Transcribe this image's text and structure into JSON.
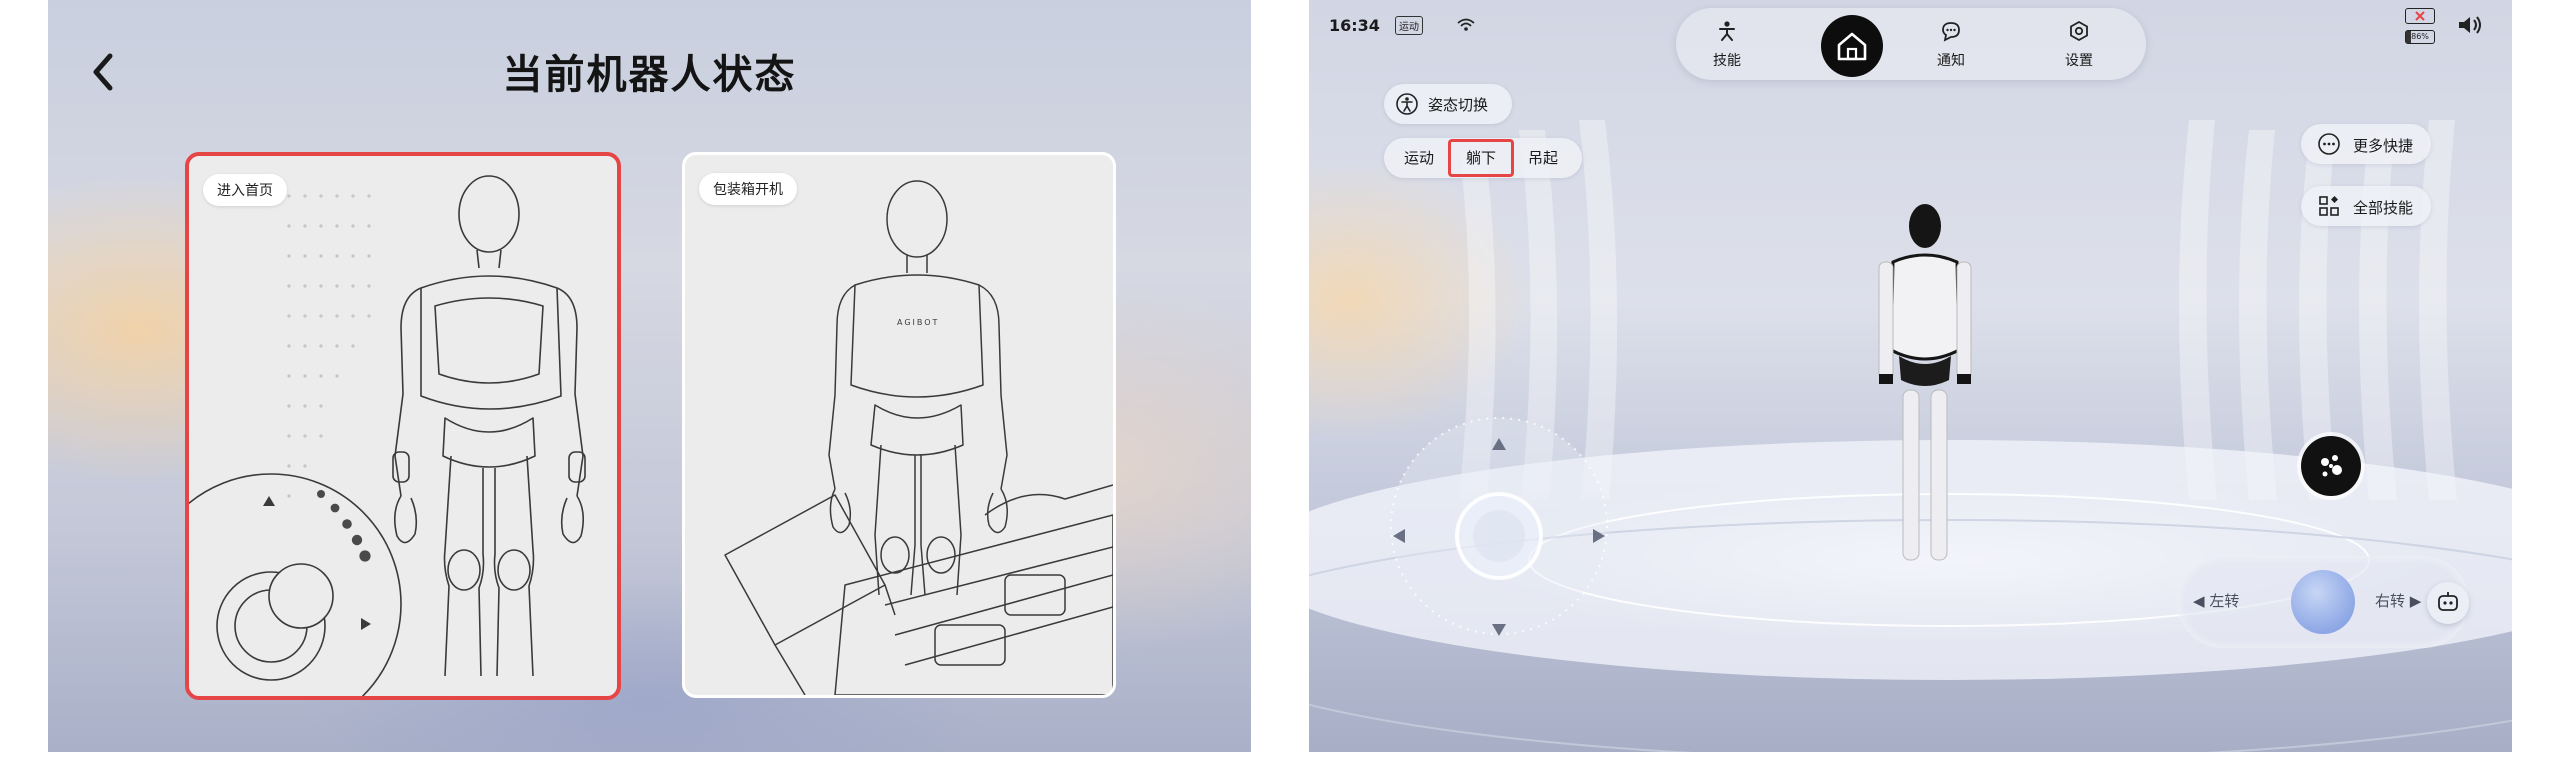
{
  "left_screen": {
    "title": "当前机器人状态",
    "back_icon": "chevron-left-icon",
    "cards": [
      {
        "label": "进入首页",
        "selected": true,
        "highlight_color": "#e64545"
      },
      {
        "label": "包装箱开机",
        "selected": false,
        "brand_text": "AGIBOT"
      }
    ]
  },
  "right_screen": {
    "status_bar": {
      "time": "16:34",
      "mode_badge": "运动",
      "battery_percent": "86%"
    },
    "nav": {
      "skills": "技能",
      "notifications": "通知",
      "settings": "设置",
      "home_icon": "home-icon"
    },
    "posture_switch": "姿态切换",
    "posture_options": [
      "运动",
      "躺下",
      "吊起"
    ],
    "posture_selected": "躺下",
    "more_shortcuts": "更多快捷",
    "all_skills": "全部技能",
    "turn_left": "左转",
    "turn_right": "右转",
    "accent_color": "#e64545"
  }
}
